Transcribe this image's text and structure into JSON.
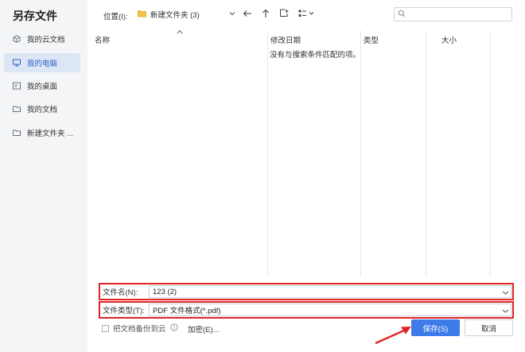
{
  "dialog": {
    "title": "另存文件"
  },
  "sidebar": {
    "items": [
      {
        "label": "我的云文档",
        "icon": "cloud-doc-icon"
      },
      {
        "label": "我的电脑",
        "icon": "monitor-icon",
        "active": true
      },
      {
        "label": "我的桌面",
        "icon": "desktop-icon"
      },
      {
        "label": "我的文档",
        "icon": "folder-icon"
      },
      {
        "label": "新建文件夹 ...",
        "icon": "folder-icon"
      }
    ]
  },
  "toolbar": {
    "location_label": "位置(I):",
    "location_value": "新建文件夹 (3)",
    "icons": [
      "back-arrow-icon",
      "up-arrow-icon",
      "new-folder-icon",
      "view-mode-icon"
    ]
  },
  "search": {
    "placeholder": ""
  },
  "table": {
    "columns": [
      "名称",
      "修改日期",
      "类型",
      "大小"
    ],
    "empty_message": "没有与搜索条件匹配的项。"
  },
  "fields": {
    "filename_label": "文件名(N):",
    "filename_value": "123 (2)",
    "filetype_label": "文件类型(T):",
    "filetype_value": "PDF 文件格式(*.pdf)"
  },
  "footer": {
    "backup_label": "把文档备份到云",
    "encrypt_label": "加密(E)...",
    "save_label": "保存(S)",
    "cancel_label": "取消"
  },
  "colors": {
    "accent": "#3c7be8",
    "highlight_border": "#e02424",
    "sidebar_bg": "#f4f5f7",
    "sidebar_active_bg": "#dde6f5",
    "folder": "#f5c242"
  }
}
